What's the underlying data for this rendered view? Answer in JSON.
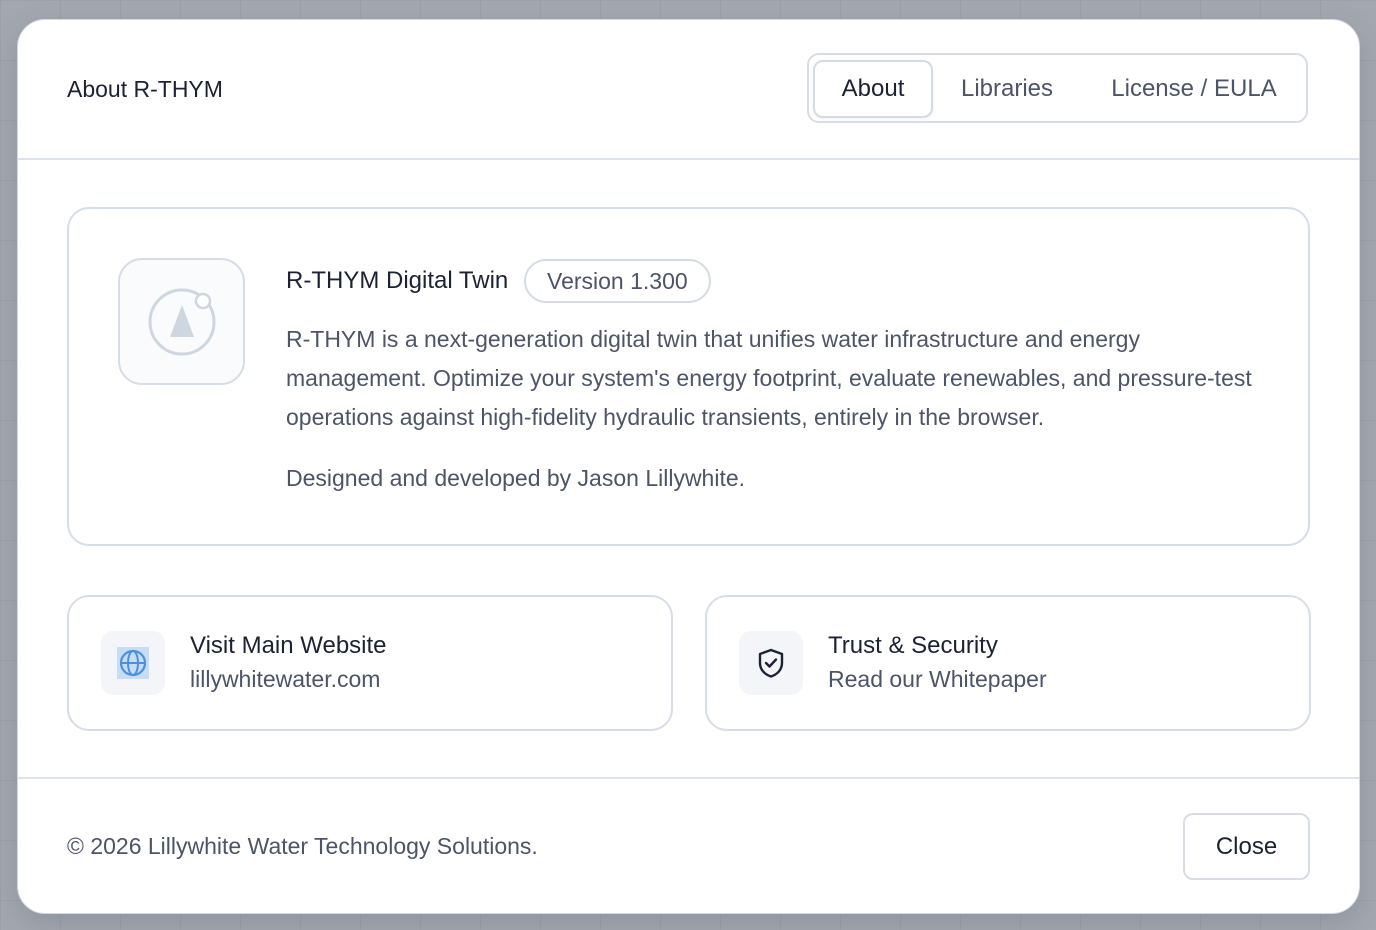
{
  "dialog": {
    "title": "About R-THYM",
    "tabs": [
      {
        "label": "About",
        "active": true
      },
      {
        "label": "Libraries",
        "active": false
      },
      {
        "label": "License / EULA",
        "active": false
      }
    ]
  },
  "product": {
    "name": "R-THYM Digital Twin",
    "version": "Version 1.300",
    "description": "R-THYM is a next-generation digital twin that unifies water infrastructure and energy management. Optimize your system's energy footprint, evaluate renewables, and pressure-test operations against high-fidelity hydraulic transients, entirely in the browser.",
    "credit": "Designed and developed by Jason Lillywhite.",
    "logo_icon": "rthym-logo-icon"
  },
  "links": [
    {
      "title": "Visit Main Website",
      "subtitle": "lillywhitewater.com",
      "icon": "globe-icon"
    },
    {
      "title": "Trust & Security",
      "subtitle": "Read our Whitepaper",
      "icon": "shield-check-icon"
    }
  ],
  "footer": {
    "copyright": "© 2026 Lillywhite Water Technology Solutions.",
    "close_label": "Close"
  },
  "colors": {
    "overlay": "#a3a8b0",
    "text_primary": "#1a2233",
    "text_secondary": "#4b5567",
    "border": "#d6dde7",
    "globe_accent": "#4a90e2"
  }
}
